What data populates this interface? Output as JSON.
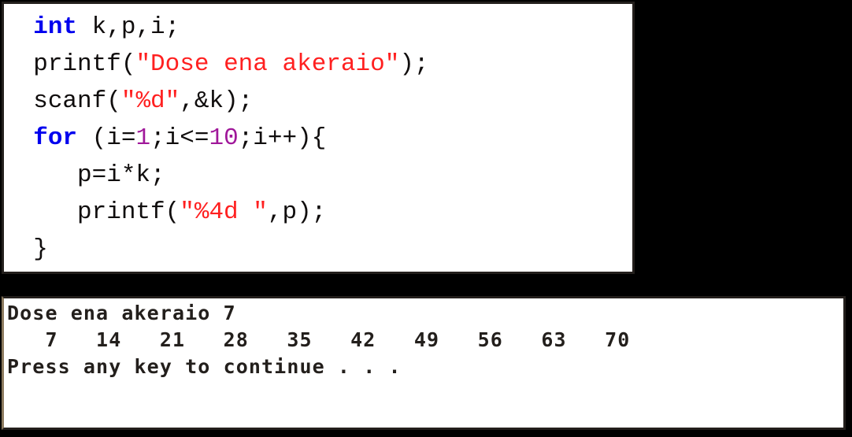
{
  "background_color": "#000000",
  "editor": {
    "background_color": "#ffffff",
    "border_color": "#231f1c",
    "syntax_colors": {
      "keyword": "#0000ee",
      "string": "#ff2020",
      "number": "#a0189a",
      "plain": "#100d0d"
    },
    "code_lines": [
      {
        "indent": "  ",
        "tokens": [
          {
            "type": "keyword",
            "text": "int"
          },
          {
            "type": "plain",
            "text": " k,p,i;"
          }
        ],
        "plain_text": "  int k,p,i;"
      },
      {
        "indent": "  ",
        "tokens": [
          {
            "type": "plain",
            "text": "printf("
          },
          {
            "type": "string",
            "text": "\"Dose ena akeraio\""
          },
          {
            "type": "plain",
            "text": ");"
          }
        ],
        "plain_text": "  printf(\"Dose ena akeraio\");"
      },
      {
        "indent": "  ",
        "tokens": [
          {
            "type": "plain",
            "text": "scanf("
          },
          {
            "type": "string",
            "text": "\"%d\""
          },
          {
            "type": "plain",
            "text": ",&k);"
          }
        ],
        "plain_text": "  scanf(\"%d\",&k);"
      },
      {
        "indent": "  ",
        "tokens": [
          {
            "type": "keyword",
            "text": "for"
          },
          {
            "type": "plain",
            "text": " (i="
          },
          {
            "type": "number",
            "text": "1"
          },
          {
            "type": "plain",
            "text": ";i<="
          },
          {
            "type": "number",
            "text": "10"
          },
          {
            "type": "plain",
            "text": ";i++){"
          }
        ],
        "plain_text": "  for (i=1;i<=10;i++){"
      },
      {
        "indent": "     ",
        "tokens": [
          {
            "type": "plain",
            "text": "p=i*k;"
          }
        ],
        "plain_text": "     p=i*k;"
      },
      {
        "indent": "     ",
        "tokens": [
          {
            "type": "plain",
            "text": "printf("
          },
          {
            "type": "string",
            "text": "\"%4d \""
          },
          {
            "type": "plain",
            "text": ",p);"
          }
        ],
        "plain_text": "     printf(\"%4d \",p);"
      },
      {
        "indent": "  ",
        "tokens": [
          {
            "type": "plain",
            "text": "}"
          }
        ],
        "plain_text": "  }"
      }
    ]
  },
  "console": {
    "background_color": "#ffffff",
    "text_color": "#231f1c",
    "border_color": "#231f1c",
    "prompt_text": "Dose ena akeraio",
    "user_input": "7",
    "output_values": [
      7,
      14,
      21,
      28,
      35,
      42,
      49,
      56,
      63,
      70
    ],
    "pause_message": "Press any key to continue . . .",
    "lines": [
      "Dose ena akeraio 7",
      "   7   14   21   28   35   42   49   56   63   70 ",
      "Press any key to continue . . ."
    ]
  }
}
